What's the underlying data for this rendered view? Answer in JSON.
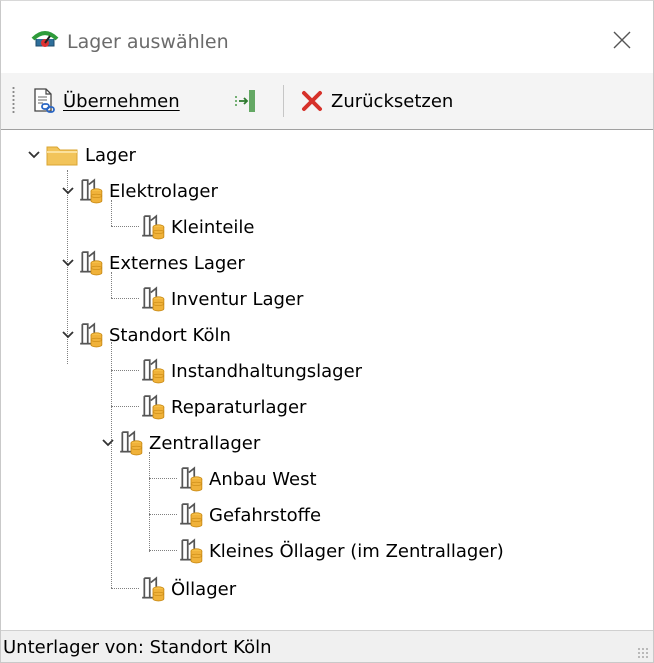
{
  "window": {
    "title": "Lager auswählen",
    "app_icon": "warehouse-app-icon",
    "close_icon": "close-icon"
  },
  "toolbar": {
    "apply_label": "Übernehmen",
    "apply_icon": "document-link-icon",
    "collapse_icon": "column-split-icon",
    "reset_label": "Zurücksetzen",
    "reset_icon": "red-x-icon"
  },
  "tree": {
    "root": "Lager",
    "nodes": [
      "Elektrolager",
      "Kleinteile",
      "Externes Lager",
      "Inventur Lager",
      "Standort Köln",
      "Instandhaltungslager",
      "Reparaturlager",
      "Zentrallager",
      "Anbau West",
      "Gefahrstoffe",
      "Kleines Öllager (im Zentrallager)",
      "Öllager"
    ]
  },
  "status": {
    "text": "Unterlager von: Standort Köln"
  },
  "colors": {
    "folder": "#f2c45a",
    "db_cylinder": "#f0b23a",
    "reset_x": "#d6312a"
  }
}
